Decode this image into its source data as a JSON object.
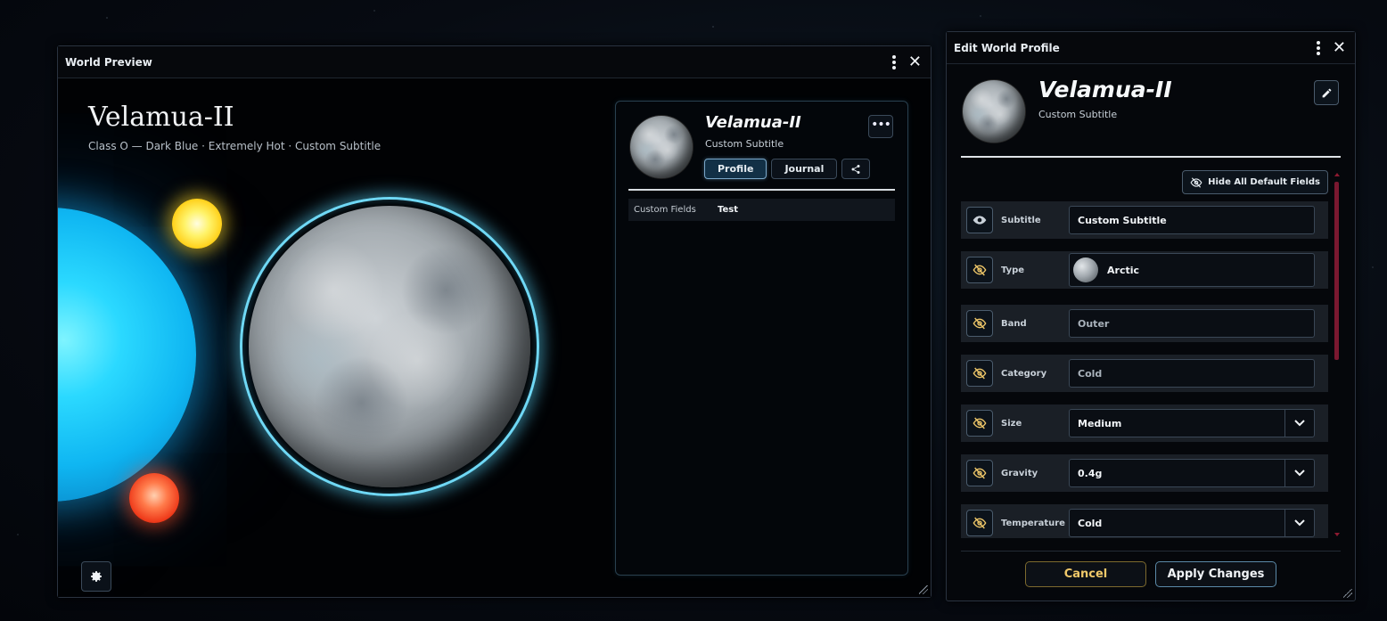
{
  "preview": {
    "window_title": "World Preview",
    "world_name": "Velamua-II",
    "world_subtitle": "Class O — Dark Blue · Extremely Hot · Custom Subtitle",
    "card": {
      "name": "Velamua-II",
      "subtitle": "Custom Subtitle",
      "more_label": "•••",
      "tabs": [
        {
          "label": "Profile",
          "active": true
        },
        {
          "label": "Journal",
          "active": false
        }
      ],
      "fields": [
        {
          "key": "Custom Fields",
          "value": "Test"
        }
      ]
    }
  },
  "editor": {
    "window_title": "Edit World Profile",
    "world_name": "Velamua-II",
    "world_subtitle": "Custom Subtitle",
    "hide_all_label": "Hide All Default Fields",
    "fields": [
      {
        "label": "Subtitle",
        "value": "Custom Subtitle",
        "visible": true,
        "kind": "text"
      },
      {
        "label": "Type",
        "value": "Arctic",
        "visible": false,
        "kind": "type"
      },
      {
        "label": "Band",
        "value": "Outer",
        "visible": false,
        "kind": "placeholder"
      },
      {
        "label": "Category",
        "value": "Cold",
        "visible": false,
        "kind": "placeholder"
      },
      {
        "label": "Size",
        "value": "Medium",
        "visible": false,
        "kind": "select"
      },
      {
        "label": "Gravity",
        "value": "0.4g",
        "visible": false,
        "kind": "select"
      },
      {
        "label": "Temperature",
        "value": "Cold",
        "visible": false,
        "kind": "select"
      }
    ],
    "cancel_label": "Cancel",
    "apply_label": "Apply Changes"
  },
  "colors": {
    "accent_ring": "#6fd8f5",
    "hidden_eye": "#f0c869",
    "cancel": "#f0c869",
    "scrollbar": "#7a1830"
  },
  "icons": [
    "kebab-menu-icon",
    "close-icon",
    "gear-icon",
    "share-icon",
    "pencil-icon",
    "eye-icon",
    "eye-off-icon",
    "chevron-down-icon"
  ]
}
